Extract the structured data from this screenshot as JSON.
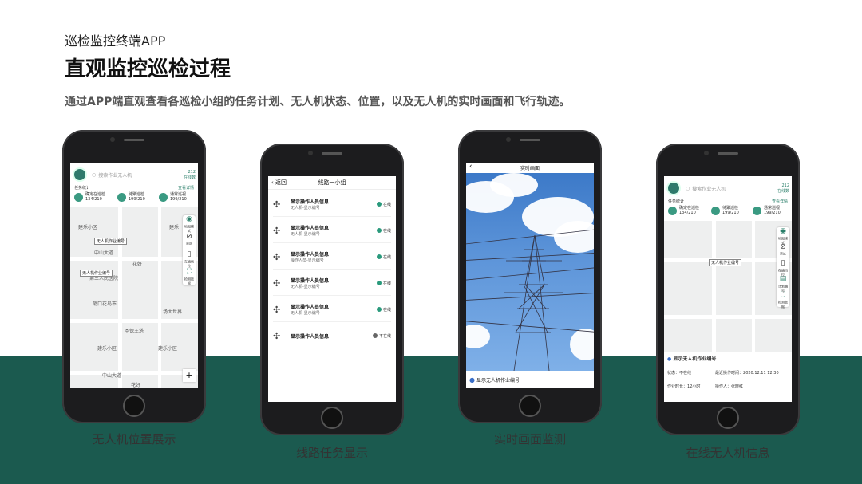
{
  "header": {
    "subtitle": "巡检监控终端APP",
    "title": "直观监控巡检过程",
    "description": "通过APP端直观查看各巡检小组的任务计划、无人机状态、位置，以及无人机的实时画面和飞行轨迹。"
  },
  "captions": [
    "无人机位置展示",
    "线路任务显示",
    "实时画面监测",
    "在线无人机信息"
  ],
  "phone1": {
    "search_placeholder": "搜索作业无人机",
    "top_right": [
      "212",
      "在线数"
    ],
    "task_title": "任务统计",
    "task_link": "查看详情",
    "stats": [
      {
        "label": "确定在巡检",
        "value": "134/210"
      },
      {
        "label": "待聚巡检",
        "value": "199/210"
      },
      {
        "label": "通常巡视",
        "value": "199/210"
      }
    ],
    "map_labels": [
      "建乐小区",
      "中山大道",
      "花好",
      "建乐",
      "第三人民医院",
      "砺口花鸟市",
      "场大世界",
      "圣保王塔",
      "建乐小区",
      "建乐小区",
      "中山大道",
      "花好"
    ],
    "pins": [
      "无人机作业编号",
      "无人机作业编号"
    ],
    "toolbar": [
      "地图模式",
      "禁区",
      "在编档位",
      "检测数据"
    ],
    "plus": "+"
  },
  "phone2": {
    "back": "返回",
    "title": "线路一小组",
    "rows": [
      {
        "name": "显示操作人员信息",
        "sub": "无人机-显示编号",
        "status": "在线"
      },
      {
        "name": "显示操作人员信息",
        "sub": "无人机-显示编号",
        "status": "在线"
      },
      {
        "name": "显示操作人员信息",
        "sub": "操作人员-显示编号",
        "status": "在线"
      },
      {
        "name": "显示操作人员信息",
        "sub": "无人机-显示编号",
        "status": "在线"
      },
      {
        "name": "显示操作人员信息",
        "sub": "无人机-显示编号",
        "status": "在线"
      },
      {
        "name": "显示操作人员信息",
        "sub": "",
        "status": "不在线"
      }
    ]
  },
  "phone3": {
    "title": "实时画面",
    "footer": "显示无人机作业编号"
  },
  "phone4": {
    "search_placeholder": "搜索作业无人机",
    "top_right": [
      "212",
      "在线数"
    ],
    "task_title": "任务统计",
    "task_link": "查看详情",
    "stats": [
      {
        "label": "确定在巡检",
        "value": "134/210"
      },
      {
        "label": "待聚巡检",
        "value": "199/210"
      },
      {
        "label": "通常巡视",
        "value": "199/210"
      }
    ],
    "pin": "无人机作业编号",
    "toolbar": [
      "地图模式",
      "禁区",
      "在编档位",
      "计划编号",
      "检测数据"
    ],
    "info_title": "显示无人机作业编号",
    "status_label": "状态：",
    "status_value": "不在线",
    "recent_label": "最近操作时间：",
    "recent_value": "2020.12.11  12:30",
    "duration_label": "作业时长：",
    "duration_value": "12小时",
    "operator_label": "操作人：",
    "operator_value": "张晓红"
  }
}
